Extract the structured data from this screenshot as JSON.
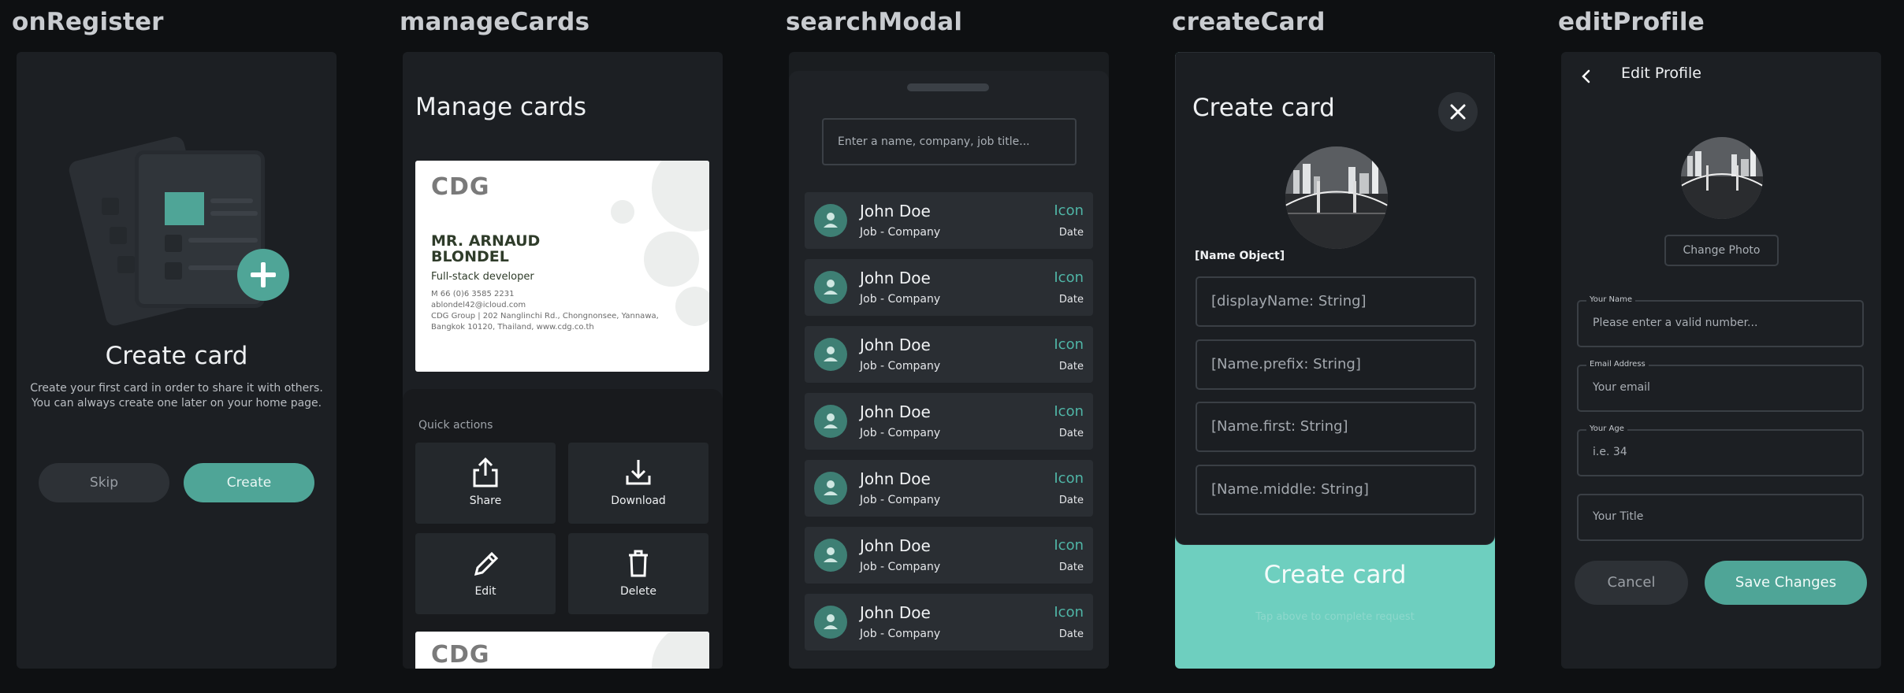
{
  "frames": {
    "onRegister": {
      "label": "onRegister",
      "title": "Create card",
      "body_line1": "Create your first card in order to share it with others.",
      "body_line2": "You can always create one later on your home page.",
      "skip_label": "Skip",
      "create_label": "Create"
    },
    "manageCards": {
      "label": "manageCards",
      "title": "Manage cards",
      "card": {
        "logo": "CDG",
        "name_line1": "MR. ARNAUD",
        "name_line2": "BLONDEL",
        "role": "Full-stack developer",
        "phone": "M 66 (0)6 3585 2231",
        "email": "ablondel42@icloud.com",
        "address_line1": "CDG Group | 202 Nanglinchi Rd., Chongnonsee, Yannawa,",
        "address_line2": "Bangkok 10120, Thailand, www.cdg.co.th"
      },
      "quick_actions_label": "Quick actions",
      "actions": [
        {
          "label": "Share",
          "icon": "share-icon"
        },
        {
          "label": "Download",
          "icon": "download-icon"
        },
        {
          "label": "Edit",
          "icon": "pencil-icon"
        },
        {
          "label": "Delete",
          "icon": "trash-icon"
        }
      ],
      "second_card_logo": "CDG"
    },
    "searchModal": {
      "label": "searchModal",
      "search_placeholder": "Enter a name, company, job title...",
      "results": [
        {
          "name": "John Doe",
          "job": "Job - Company",
          "icon": "Icon",
          "date": "Date"
        },
        {
          "name": "John Doe",
          "job": "Job - Company",
          "icon": "Icon",
          "date": "Date"
        },
        {
          "name": "John Doe",
          "job": "Job - Company",
          "icon": "Icon",
          "date": "Date"
        },
        {
          "name": "John Doe",
          "job": "Job - Company",
          "icon": "Icon",
          "date": "Date"
        },
        {
          "name": "John Doe",
          "job": "Job - Company",
          "icon": "Icon",
          "date": "Date"
        },
        {
          "name": "John Doe",
          "job": "Job - Company",
          "icon": "Icon",
          "date": "Date"
        },
        {
          "name": "John Doe",
          "job": "Job - Company",
          "icon": "Icon",
          "date": "Date"
        }
      ]
    },
    "createCard": {
      "label": "createCard",
      "title": "Create card",
      "object_label": "[Name Object]",
      "inputs": [
        "[displayName: String]",
        "[Name.prefix: String]",
        "[Name.first: String]",
        "[Name.middle: String]"
      ],
      "submit_label": "Create card",
      "hint": "Tap above to complete request"
    },
    "editProfile": {
      "label": "editProfile",
      "title": "Edit Profile",
      "change_photo": "Change Photo",
      "fields": [
        {
          "legend": "Your Name",
          "value": "Please enter a valid number..."
        },
        {
          "legend": "Email Address",
          "value": "Your email"
        },
        {
          "legend": "Your Age",
          "value": "i.e. 34"
        },
        {
          "legend": "",
          "value": "Your Title"
        }
      ],
      "cancel_label": "Cancel",
      "save_label": "Save Changes"
    }
  },
  "colors": {
    "accent": "#4fa597",
    "accent_light": "#6ecfbf",
    "background": "#0e1012",
    "panel": "#1c1f23"
  }
}
